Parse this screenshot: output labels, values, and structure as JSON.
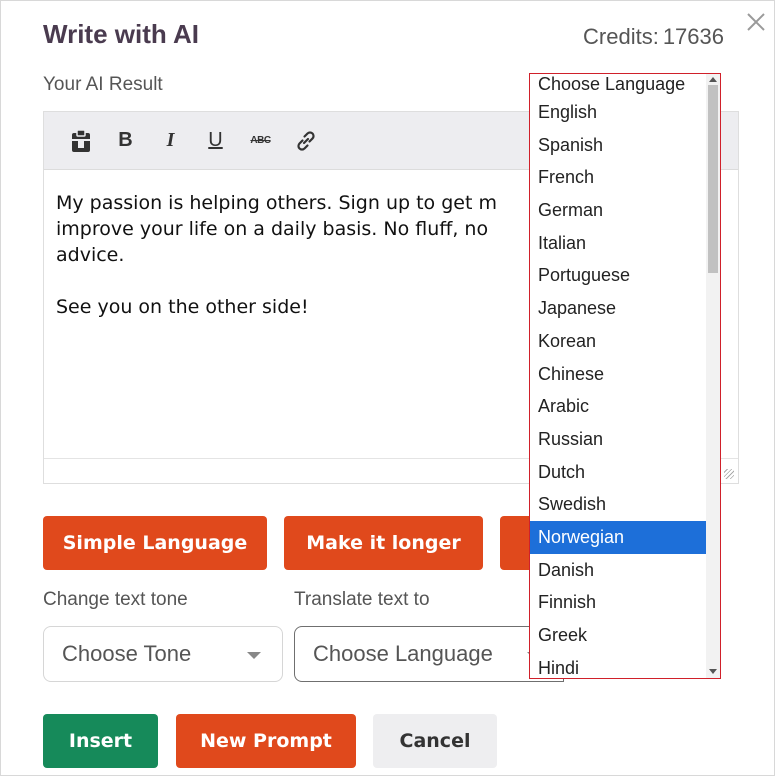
{
  "dialog": {
    "title": "Write with AI",
    "credits_label": "Credits:",
    "credits_value": "17636",
    "close_icon": "close-icon"
  },
  "editor": {
    "label": "Your AI Result",
    "toolbar": {
      "paste_icon": "clipboard-icon",
      "bold": "B",
      "italic": "I",
      "underline": "U",
      "strike": "ABC",
      "link_icon": "link-icon"
    },
    "lines": [
      "My passion is helping others. Sign up to get m",
      "improve your life on a daily basis. No fluff, no",
      "advice."
    ],
    "closing": "See you on the other side!"
  },
  "actions": {
    "simple_language": "Simple Language",
    "make_longer": "Make it longer"
  },
  "tone": {
    "label": "Change text tone",
    "value": "Choose Tone"
  },
  "translate": {
    "label": "Translate text to",
    "value": "Choose Language"
  },
  "footer": {
    "insert": "Insert",
    "new_prompt": "New Prompt",
    "cancel": "Cancel"
  },
  "language_dropdown": {
    "selected": "Norwegian",
    "options": [
      "Choose Language",
      "English",
      "Spanish",
      "French",
      "German",
      "Italian",
      "Portuguese",
      "Japanese",
      "Korean",
      "Chinese",
      "Arabic",
      "Russian",
      "Dutch",
      "Swedish",
      "Norwegian",
      "Danish",
      "Finnish",
      "Greek",
      "Hindi"
    ]
  },
  "colors": {
    "accent_orange": "#e0491c",
    "insert_green": "#168a5a",
    "selection_blue": "#1d6fd9",
    "title_color": "#4a3b4f"
  }
}
